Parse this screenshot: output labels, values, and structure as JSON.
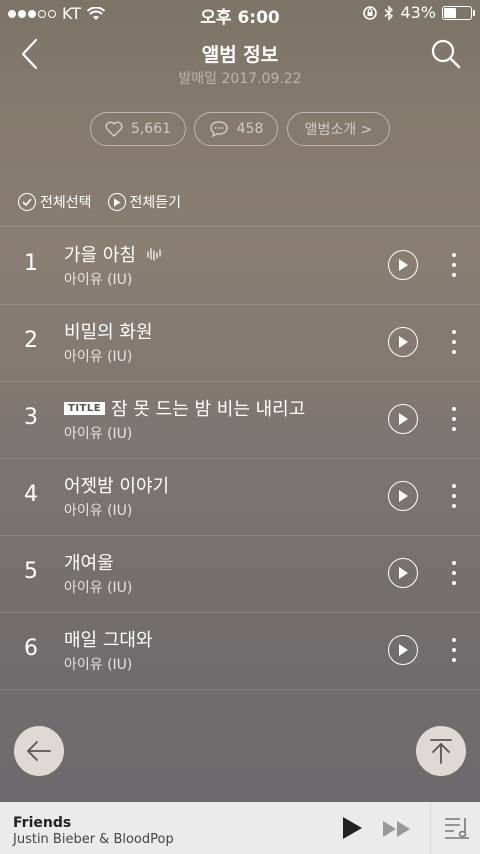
{
  "status": {
    "carrier": "KT",
    "time": "오후 6:00",
    "battery": "43%",
    "battery_level": 0.43
  },
  "header": {
    "title": "앨범 정보",
    "release": "발매일 2017.09.22"
  },
  "stats": {
    "likes": "5,661",
    "comments": "458",
    "intro_label": "앨범소개 >"
  },
  "actions": {
    "select_all": "전체선택",
    "play_all": "전체듣기"
  },
  "tracks": [
    {
      "num": "1",
      "name": "가을 아침",
      "artist": "아이유 (IU)"
    },
    {
      "num": "2",
      "name": "비밀의 화원",
      "artist": "아이유 (IU)"
    },
    {
      "num": "3",
      "badge": "TITLE",
      "name": "잠 못 드는 밤 비는 내리고",
      "artist": "아이유 (IU)"
    },
    {
      "num": "4",
      "name": "어젯밤 이야기",
      "artist": "아이유 (IU)"
    },
    {
      "num": "5",
      "name": "개여울",
      "artist": "아이유 (IU)"
    },
    {
      "num": "6",
      "name": "매일 그대와",
      "artist": "아이유 (IU)"
    }
  ],
  "player": {
    "title": "Friends",
    "artist": "Justin Bieber & BloodPop"
  },
  "icons": {
    "back": "arrow-left-icon",
    "search": "search-icon",
    "heart": "heart-icon",
    "comment": "comment-icon",
    "play": "play-icon",
    "more": "more-vertical-icon",
    "top": "arrow-up-icon",
    "next": "fast-forward-icon",
    "playlist": "playlist-icon"
  }
}
